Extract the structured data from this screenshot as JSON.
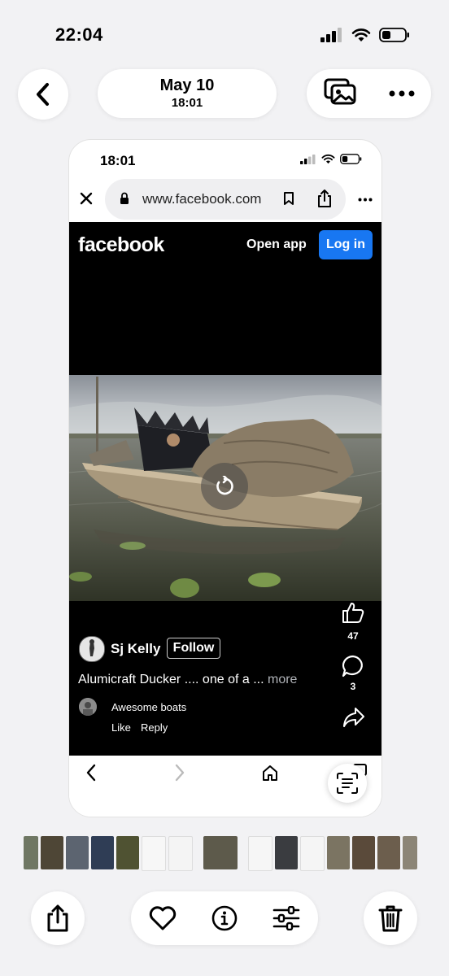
{
  "status_bar": {
    "time": "22:04"
  },
  "header": {
    "date_title": "May 10",
    "date_time": "18:01"
  },
  "screenshot": {
    "status_time": "18:01",
    "browser": {
      "url": "www.facebook.com"
    },
    "facebook": {
      "logo": "facebook",
      "open_app_label": "Open app",
      "login_label": "Log in",
      "likes": "47",
      "comments": "3",
      "author": "Sj Kelly",
      "follow_label": "Follow",
      "caption": "Alumicraft Ducker .... one of a ...",
      "caption_more": "more",
      "comment": {
        "text": "Awesome boats",
        "like_label": "Like",
        "reply_label": "Reply"
      }
    },
    "accent": "#1877f2"
  },
  "icons": {
    "back": "chevron-left-icon",
    "gallery": "photo-stack-icon",
    "more": "ellipsis-icon",
    "share": "share-icon",
    "favorite": "heart-icon",
    "info": "info-icon",
    "adjust": "sliders-icon",
    "delete": "trash-icon"
  }
}
